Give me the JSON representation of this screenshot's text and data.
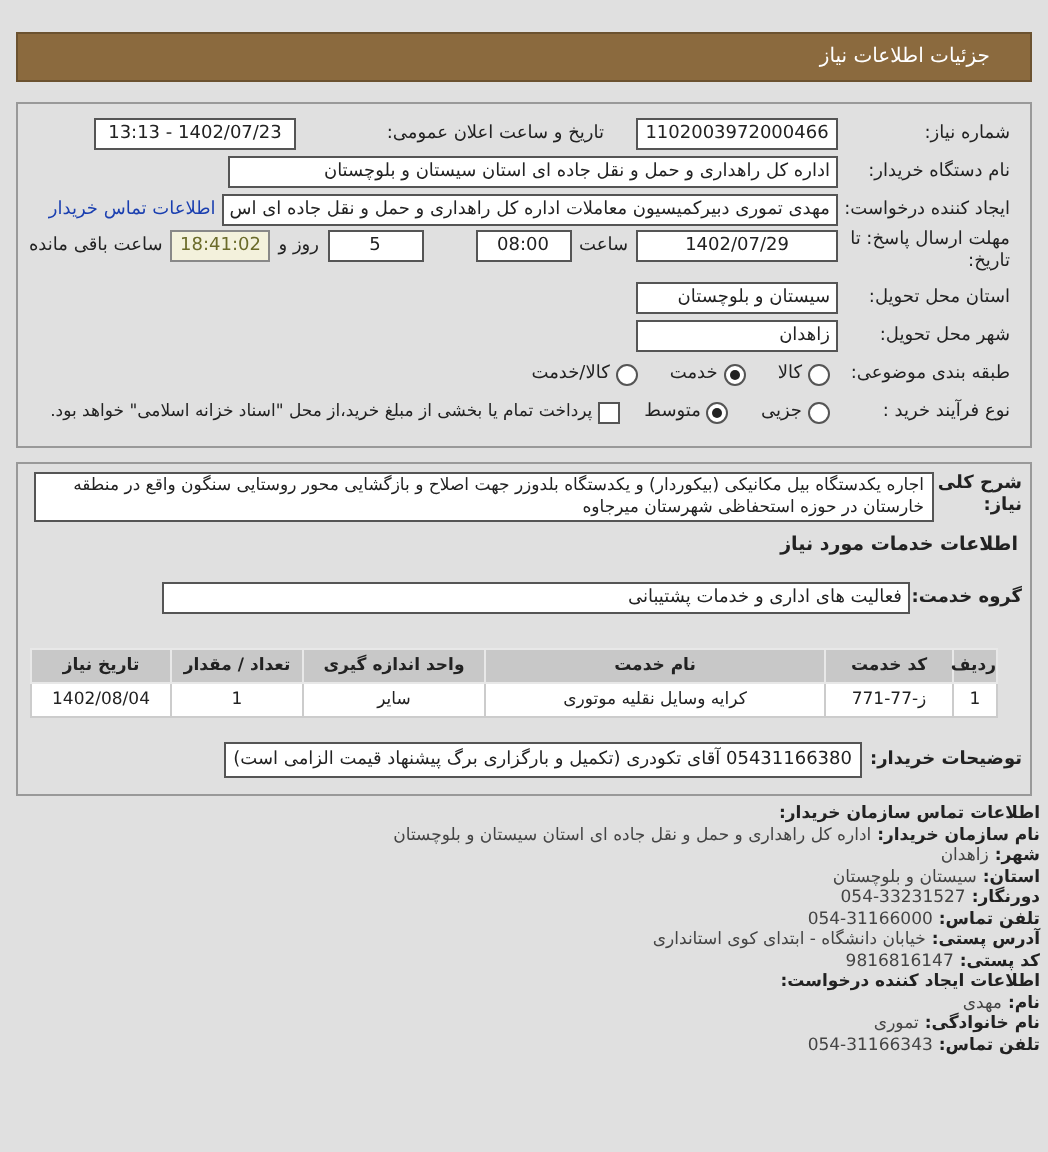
{
  "header": {
    "title": "جزئیات اطلاعات نیاز"
  },
  "details": {
    "need_number": {
      "label": "شماره نیاز:",
      "value": "1102003972000466"
    },
    "announce": {
      "label": "تاریخ و ساعت اعلان عمومی:",
      "value": "1402/07/23 - 13:13"
    },
    "buyer": {
      "label": "نام دستگاه خریدار:",
      "value": "اداره کل راهداری و حمل و نقل جاده ای استان سیستان و بلوچستان"
    },
    "requester": {
      "label": "ایجاد کننده درخواست:",
      "value": "مهدی تموری دبیرکمیسیون معاملات اداره کل راهداری و حمل و نقل جاده ای اس",
      "link": "اطلاعات تماس خریدار"
    },
    "deadline": {
      "label": "مهلت ارسال پاسخ: تا تاریخ:",
      "date": "1402/07/29",
      "time_label": "ساعت",
      "time": "08:00",
      "days": "5",
      "days_label": "روز و",
      "remaining": "18:41:02",
      "remaining_label": "ساعت باقی مانده"
    },
    "province": {
      "label": "استان محل تحویل:",
      "value": "سیستان و بلوچستان"
    },
    "city": {
      "label": "شهر محل تحویل:",
      "value": "زاهدان"
    },
    "category": {
      "label": "طبقه بندی موضوعی:",
      "options": [
        {
          "label": "کالا",
          "selected": false
        },
        {
          "label": "خدمت",
          "selected": true
        },
        {
          "label": "کالا/خدمت",
          "selected": false
        }
      ]
    },
    "process": {
      "label": "نوع فرآیند خرید :",
      "options": [
        {
          "label": "جزیی",
          "selected": false
        },
        {
          "label": "متوسط",
          "selected": true
        }
      ],
      "treasury": {
        "checked": false,
        "label": "پرداخت تمام یا بخشی از مبلغ خرید،از محل \"اسناد خزانه اسلامی\" خواهد بود."
      }
    }
  },
  "need": {
    "description": {
      "label": "شرح کلی نیاز:",
      "value": "اجاره یکدستگاه بیل مکانیکی (بیکوردار) و یکدستگاه بلدوزر جهت اصلاح و بازگشایی محور روستایی سنگون واقع در منطقه خارستان در حوزه استحفاظی شهرستان میرجاوه"
    },
    "services_heading": "اطلاعات خدمات مورد نیاز",
    "service_group": {
      "label": "گروه خدمت:",
      "value": "فعالیت های اداری و خدمات پشتیبانی"
    },
    "table": {
      "columns": [
        "ردیف",
        "کد خدمت",
        "نام خدمت",
        "واحد اندازه گیری",
        "تعداد / مقدار",
        "تاریخ نیاز"
      ],
      "rows": [
        [
          "1",
          "ز-77-771",
          "کرایه وسایل نقلیه موتوری",
          "سایر",
          "1",
          "1402/08/04"
        ]
      ]
    },
    "buyer_notes": {
      "label": "توضیحات خریدار:",
      "value": "05431166380 آقای تکودری (تکمیل و بارگزاری برگ پیشنهاد قیمت الزامی است)"
    }
  },
  "contact": [
    {
      "kind": "heading",
      "label": "اطلاعات تماس سازمان خریدار:"
    },
    {
      "kind": "line",
      "label": "نام سازمان خریدار:",
      "value": "اداره کل راهداری و حمل و نقل جاده ای استان سیستان و بلوچستان"
    },
    {
      "kind": "line",
      "label": "شهر:",
      "value": "زاهدان"
    },
    {
      "kind": "line",
      "label": "استان:",
      "value": "سیستان و بلوچستان"
    },
    {
      "kind": "line",
      "label": "دورنگار:",
      "value": "054-33231527"
    },
    {
      "kind": "line",
      "label": "تلفن تماس:",
      "value": "054-31166000"
    },
    {
      "kind": "line",
      "label": "آدرس پستی:",
      "value": "خیابان دانشگاه - ابتدای کوی استانداری"
    },
    {
      "kind": "line",
      "label": "کد پستی:",
      "value": "9816816147"
    },
    {
      "kind": "heading",
      "label": "اطلاعات ایجاد کننده درخواست:"
    },
    {
      "kind": "line",
      "label": "نام:",
      "value": "مهدی"
    },
    {
      "kind": "line",
      "label": "نام خانوادگی:",
      "value": "تموری"
    },
    {
      "kind": "line",
      "label": "تلفن تماس:",
      "value": "054-31166343"
    }
  ]
}
